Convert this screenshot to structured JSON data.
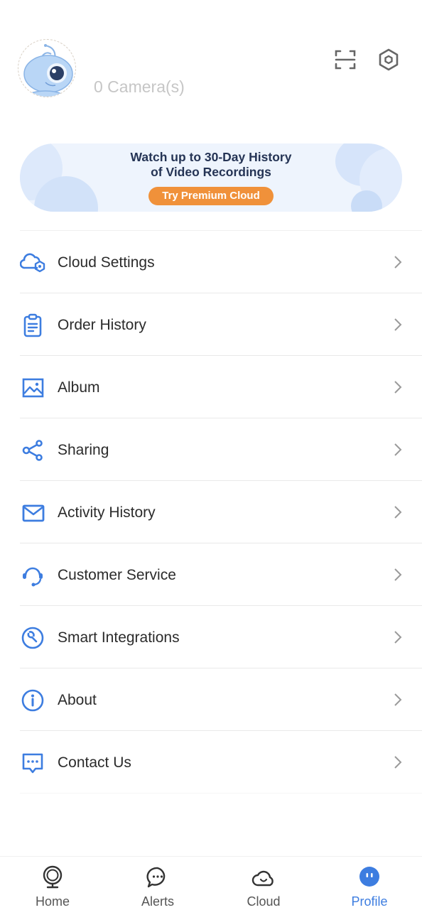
{
  "header": {
    "camera_count": "0 Camera(s)",
    "avatar_icon": "ant-mascot-avatar",
    "actions": [
      {
        "name": "scan-icon"
      },
      {
        "name": "settings-hexagon-icon"
      }
    ]
  },
  "banner": {
    "title_line1": "Watch up to 30-Day History",
    "title_line2": "of Video Recordings",
    "button_label": "Try Premium Cloud",
    "colors": {
      "button": "#f0913a",
      "title": "#253455",
      "background": "#eef4fd"
    }
  },
  "menu": {
    "items": [
      {
        "label": "Cloud Settings",
        "icon": "cloud-settings-icon"
      },
      {
        "label": "Order History",
        "icon": "clipboard-icon"
      },
      {
        "label": "Album",
        "icon": "image-icon"
      },
      {
        "label": "Sharing",
        "icon": "share-icon"
      },
      {
        "label": "Activity History",
        "icon": "mail-icon"
      },
      {
        "label": "Customer Service",
        "icon": "headset-icon"
      },
      {
        "label": "Smart Integrations",
        "icon": "wrench-icon"
      },
      {
        "label": "About",
        "icon": "info-icon"
      },
      {
        "label": "Contact Us",
        "icon": "chat-bubble-icon"
      }
    ],
    "accent": "#3d7de0"
  },
  "tabbar": {
    "tabs": [
      {
        "label": "Home",
        "icon": "camera-icon",
        "active": false
      },
      {
        "label": "Alerts",
        "icon": "message-icon",
        "active": false
      },
      {
        "label": "Cloud",
        "icon": "cloud-icon",
        "active": false
      },
      {
        "label": "Profile",
        "icon": "profile-icon",
        "active": true
      }
    ],
    "active_color": "#3d7de0"
  }
}
